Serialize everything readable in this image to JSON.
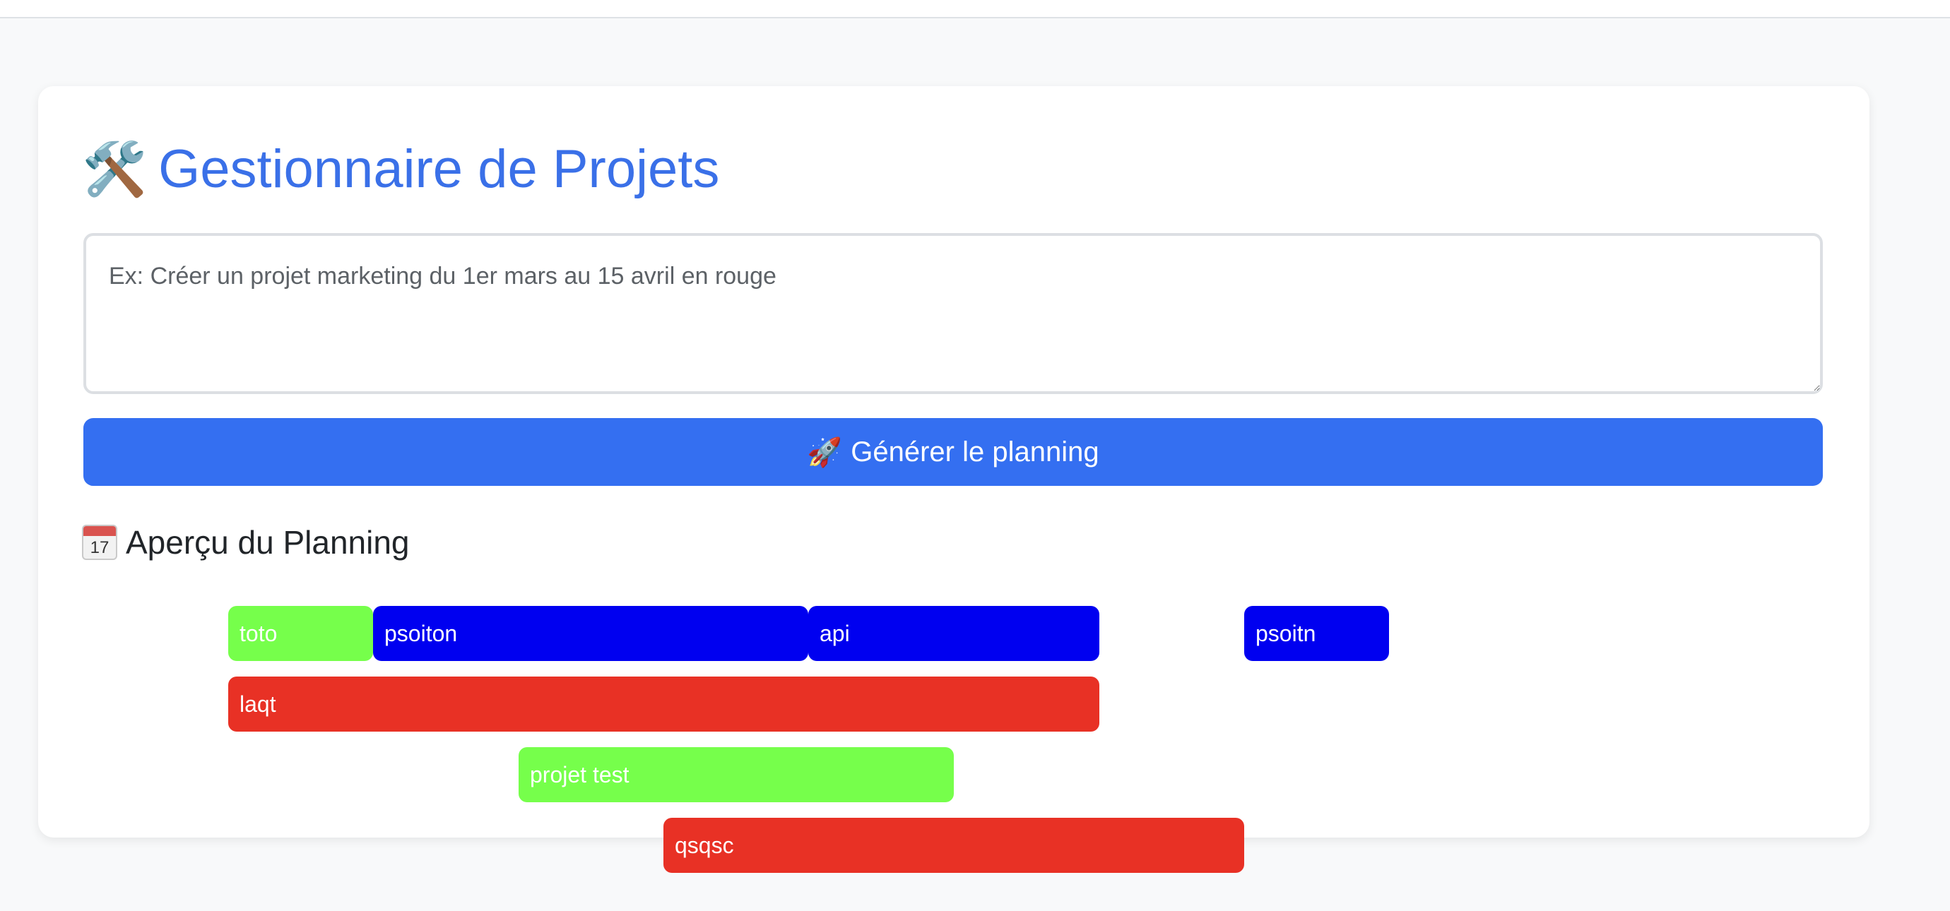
{
  "header": {
    "title": "Gestionnaire de Projets",
    "title_icon": "hammer-and-wrench-icon"
  },
  "prompt": {
    "placeholder": "Ex: Créer un projet marketing du 1er mars au 15 avril en rouge",
    "value": ""
  },
  "generate_button": {
    "label": "Générer le planning",
    "icon": "rocket-icon"
  },
  "planning": {
    "title": "Aperçu du Planning",
    "icon": "calendar-icon",
    "calendar_day": "17",
    "tasks": [
      {
        "label": "toto",
        "color": "#76ff4b",
        "row": 0
      },
      {
        "label": "psoiton",
        "color": "#0000f0",
        "row": 0
      },
      {
        "label": "api",
        "color": "#0000f0",
        "row": 0
      },
      {
        "label": "psoitn",
        "color": "#0000f0",
        "row": 0
      },
      {
        "label": "laqt",
        "color": "#e83125",
        "row": 1
      },
      {
        "label": "projet test",
        "color": "#76ff4b",
        "row": 2
      },
      {
        "label": "qsqsc",
        "color": "#e83125",
        "row": 3
      }
    ]
  }
}
